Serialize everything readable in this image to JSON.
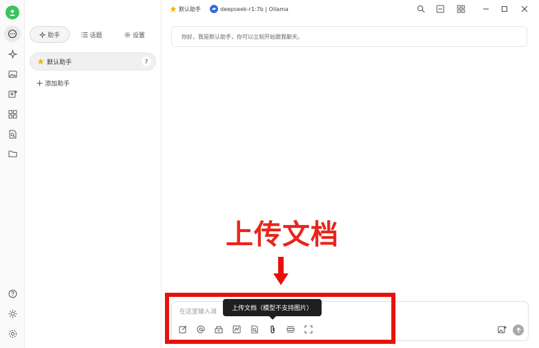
{
  "topbar": {
    "assistant_name": "默认助手",
    "model_label": "deepseek-r1:7b | Ollama"
  },
  "panel": {
    "tabs": [
      {
        "label": "助手"
      },
      {
        "label": "话题"
      },
      {
        "label": "设置"
      }
    ],
    "assistant": {
      "name": "默认助手",
      "count": "7"
    },
    "add_assistant_label": "添加助手"
  },
  "chat": {
    "greeting": "你好，我是默认助手，你可以立刻开始跟我聊天。"
  },
  "input": {
    "placeholder": "在这里输入消",
    "tooltip": "上传文档（模型不支持图片）"
  },
  "annotation": {
    "title": "上传文档"
  },
  "colors": {
    "accent_green": "#3cc35b",
    "annotation_red": "#e8251b",
    "star": "#f5b400",
    "model_badge": "#3b6be0"
  },
  "icons": {
    "rail": [
      "chat-icon",
      "sparkle-icon",
      "image-icon",
      "image-add-icon",
      "apps-icon",
      "doc-search-icon",
      "folder-icon",
      "help-icon",
      "theme-icon",
      "settings-icon"
    ],
    "toolbar": [
      "edit-icon",
      "mention-icon",
      "library-icon",
      "web-search-icon",
      "doc-search-icon",
      "paperclip-icon",
      "clear-icon",
      "expand-icon",
      "image-upload-icon",
      "send-icon"
    ]
  }
}
